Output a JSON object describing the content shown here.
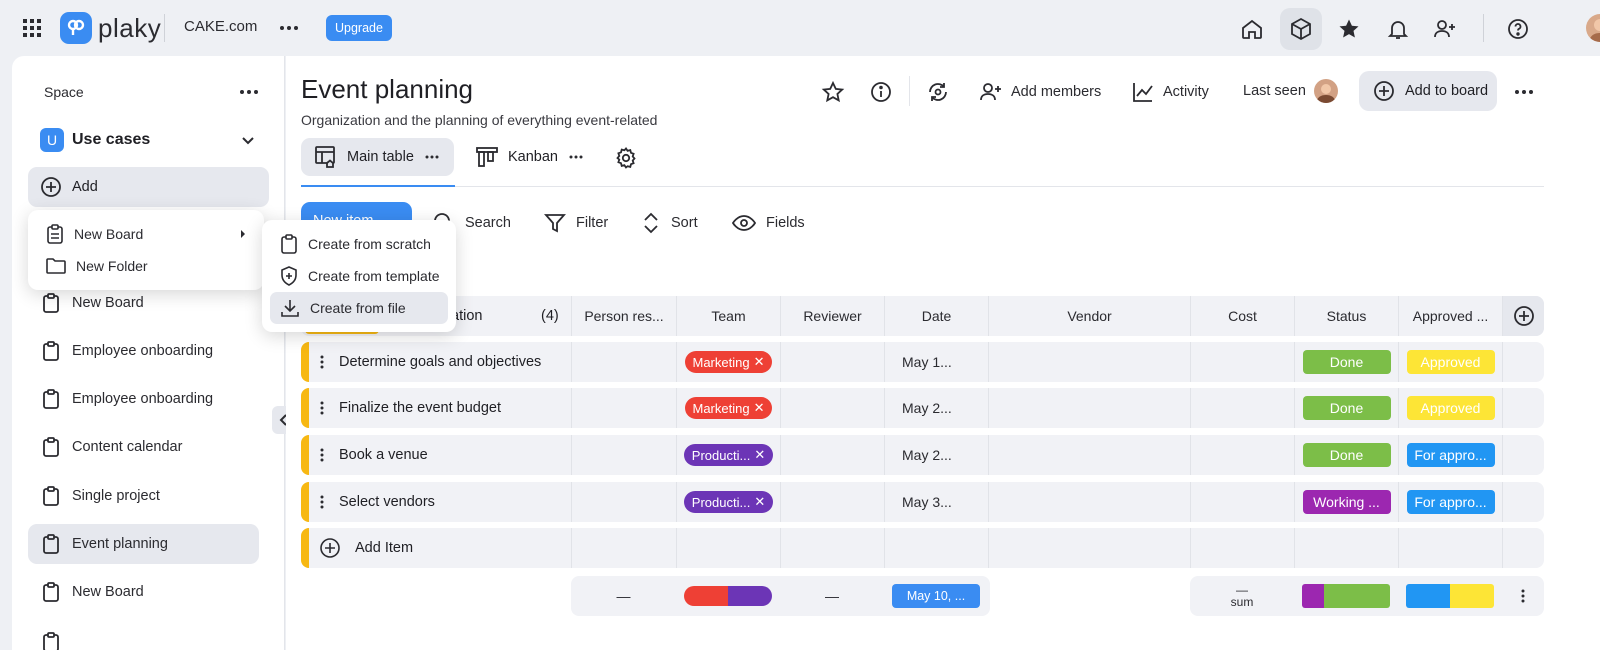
{
  "topbar": {
    "logo_text": "plaky",
    "workspace": "CAKE.com",
    "upgrade_label": "Upgrade"
  },
  "sidebar": {
    "space_label": "Space",
    "workspace_badge": "U",
    "workspace_name": "Use cases",
    "add_label": "Add",
    "items": [
      {
        "label": "New Board"
      },
      {
        "label": "Employee onboarding"
      },
      {
        "label": "Employee onboarding"
      },
      {
        "label": "Content calendar"
      },
      {
        "label": "Single project"
      },
      {
        "label": "Event planning"
      },
      {
        "label": "New Board"
      }
    ]
  },
  "add_menu": {
    "items": [
      {
        "label": "New Board"
      },
      {
        "label": "New Folder"
      }
    ]
  },
  "board_submenu": {
    "items": [
      {
        "label": "Create from scratch"
      },
      {
        "label": "Create from template"
      },
      {
        "label": "Create from file"
      }
    ]
  },
  "board": {
    "title": "Event planning",
    "subtitle": "Organization and the planning of everything event-related",
    "add_members_label": "Add members",
    "activity_label": "Activity",
    "last_seen_label": "Last seen",
    "add_to_board_label": "Add to board",
    "tabs": [
      {
        "label": "Main table"
      },
      {
        "label": "Kanban"
      }
    ],
    "new_item_label": "New item",
    "toolbar": {
      "search": "Search",
      "filter": "Filter",
      "sort": "Sort",
      "fields": "Fields"
    }
  },
  "table": {
    "group_name_visible": "ation",
    "group_count": "(4)",
    "columns": [
      "Person res...",
      "Team",
      "Reviewer",
      "Date",
      "Vendor",
      "Cost",
      "Status",
      "Approved ..."
    ],
    "rows": [
      {
        "name": "Determine goals and objectives",
        "team": "Marketing",
        "team_color": "#ee4035",
        "date": "May 1...",
        "status": "Done",
        "status_color": "#7cbe48",
        "approved": "Approved",
        "approved_color": "#fde536"
      },
      {
        "name": "Finalize the event budget",
        "team": "Marketing",
        "team_color": "#ee4035",
        "date": "May 2...",
        "status": "Done",
        "status_color": "#7cbe48",
        "approved": "Approved",
        "approved_color": "#fde536"
      },
      {
        "name": "Book a venue",
        "team": "Producti...",
        "team_color": "#6c35b6",
        "date": "May 2...",
        "status": "Done",
        "status_color": "#7cbe48",
        "approved": "For appro...",
        "approved_color": "#2196f3"
      },
      {
        "name": "Select vendors",
        "team": "Producti...",
        "team_color": "#6c35b6",
        "date": "May 3...",
        "status": "Working ...",
        "status_color": "#9c27b0",
        "approved": "For appro...",
        "approved_color": "#2196f3"
      }
    ],
    "add_item_label": "Add Item",
    "summary": {
      "person": "—",
      "reviewer": "—",
      "date_range": "May 10, ...",
      "cost_dash": "—",
      "cost_label": "sum"
    }
  },
  "colors": {
    "accent": "#3a8cf2",
    "group": "#f7b813"
  }
}
